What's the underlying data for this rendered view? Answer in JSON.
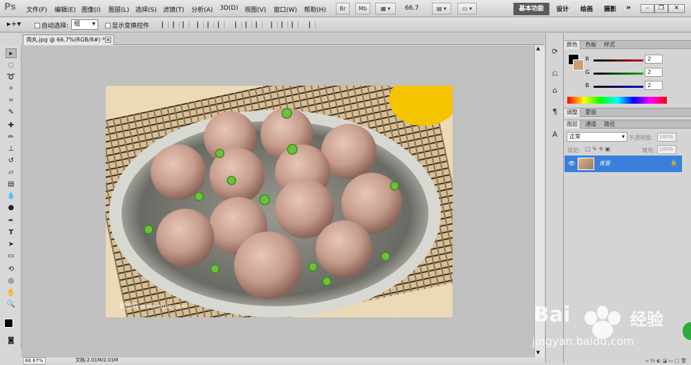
{
  "app": {
    "logo": "Ps"
  },
  "menu": [
    "文件(F)",
    "编辑(E)",
    "图像(I)",
    "图层(L)",
    "选择(S)",
    "滤镜(T)",
    "分析(A)",
    "3D(D)",
    "视图(V)",
    "窗口(W)",
    "帮助(H)"
  ],
  "appbar": {
    "br": "Br",
    "mb": "Mb",
    "zoom": "66.7"
  },
  "workspaces": {
    "active": "基本功能",
    "items": [
      "设计",
      "绘画",
      "摄影"
    ],
    "more": "»"
  },
  "options": {
    "auto_select": "自动选择:",
    "auto_select_value": "组",
    "show_transform": "显示变换控件"
  },
  "document": {
    "tab_title": "肉丸.jpg @ 66.7%(RGB/8#) *"
  },
  "status": {
    "zoom": "66.67%",
    "doc_size": "文档:2.01M/2.01M"
  },
  "color_panel": {
    "tabs": [
      "颜色",
      "色板",
      "样式"
    ],
    "channels": [
      {
        "label": "R",
        "value": "2",
        "color": "#cc0000"
      },
      {
        "label": "G",
        "value": "2",
        "color": "#00aa00"
      },
      {
        "label": "B",
        "value": "2",
        "color": "#0000cc"
      }
    ],
    "foreground": "#020202",
    "background": "#c9a07a"
  },
  "adjust_tabs": [
    "调整",
    "蒙版"
  ],
  "layers_panel": {
    "tabs": [
      "图层",
      "通道",
      "路径"
    ],
    "blend_mode": "正常",
    "opacity_label": "不透明度:",
    "opacity": "100%",
    "lock_label": "锁定:",
    "fill_label": "填充:",
    "fill": "100%",
    "layer_name": "背景"
  },
  "watermark": {
    "brand": "Bai",
    "brand_suffix": "经验",
    "url": "jingyan.baidu.com"
  }
}
